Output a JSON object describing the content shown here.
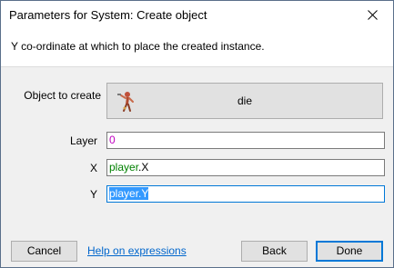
{
  "window": {
    "title": "Parameters for System: Create object",
    "close_icon": "close-icon"
  },
  "description": "Y co-ordinate at which to place the created instance.",
  "params": {
    "object_label": "Object to create",
    "object_value": "die",
    "object_icon": "sprite-figure-icon",
    "layer_label": "Layer",
    "layer_value": "0",
    "x_label": "X",
    "x_object": "player",
    "x_expression": ".X",
    "y_label": "Y",
    "y_object": "player",
    "y_expression": ".Y"
  },
  "footer": {
    "cancel": "Cancel",
    "help_link": "Help on expressions",
    "back": "Back",
    "done": "Done"
  },
  "colors": {
    "number_token": "#c000c0",
    "object_token": "#008000",
    "selection": "#3399ff",
    "link": "#0066cc"
  }
}
